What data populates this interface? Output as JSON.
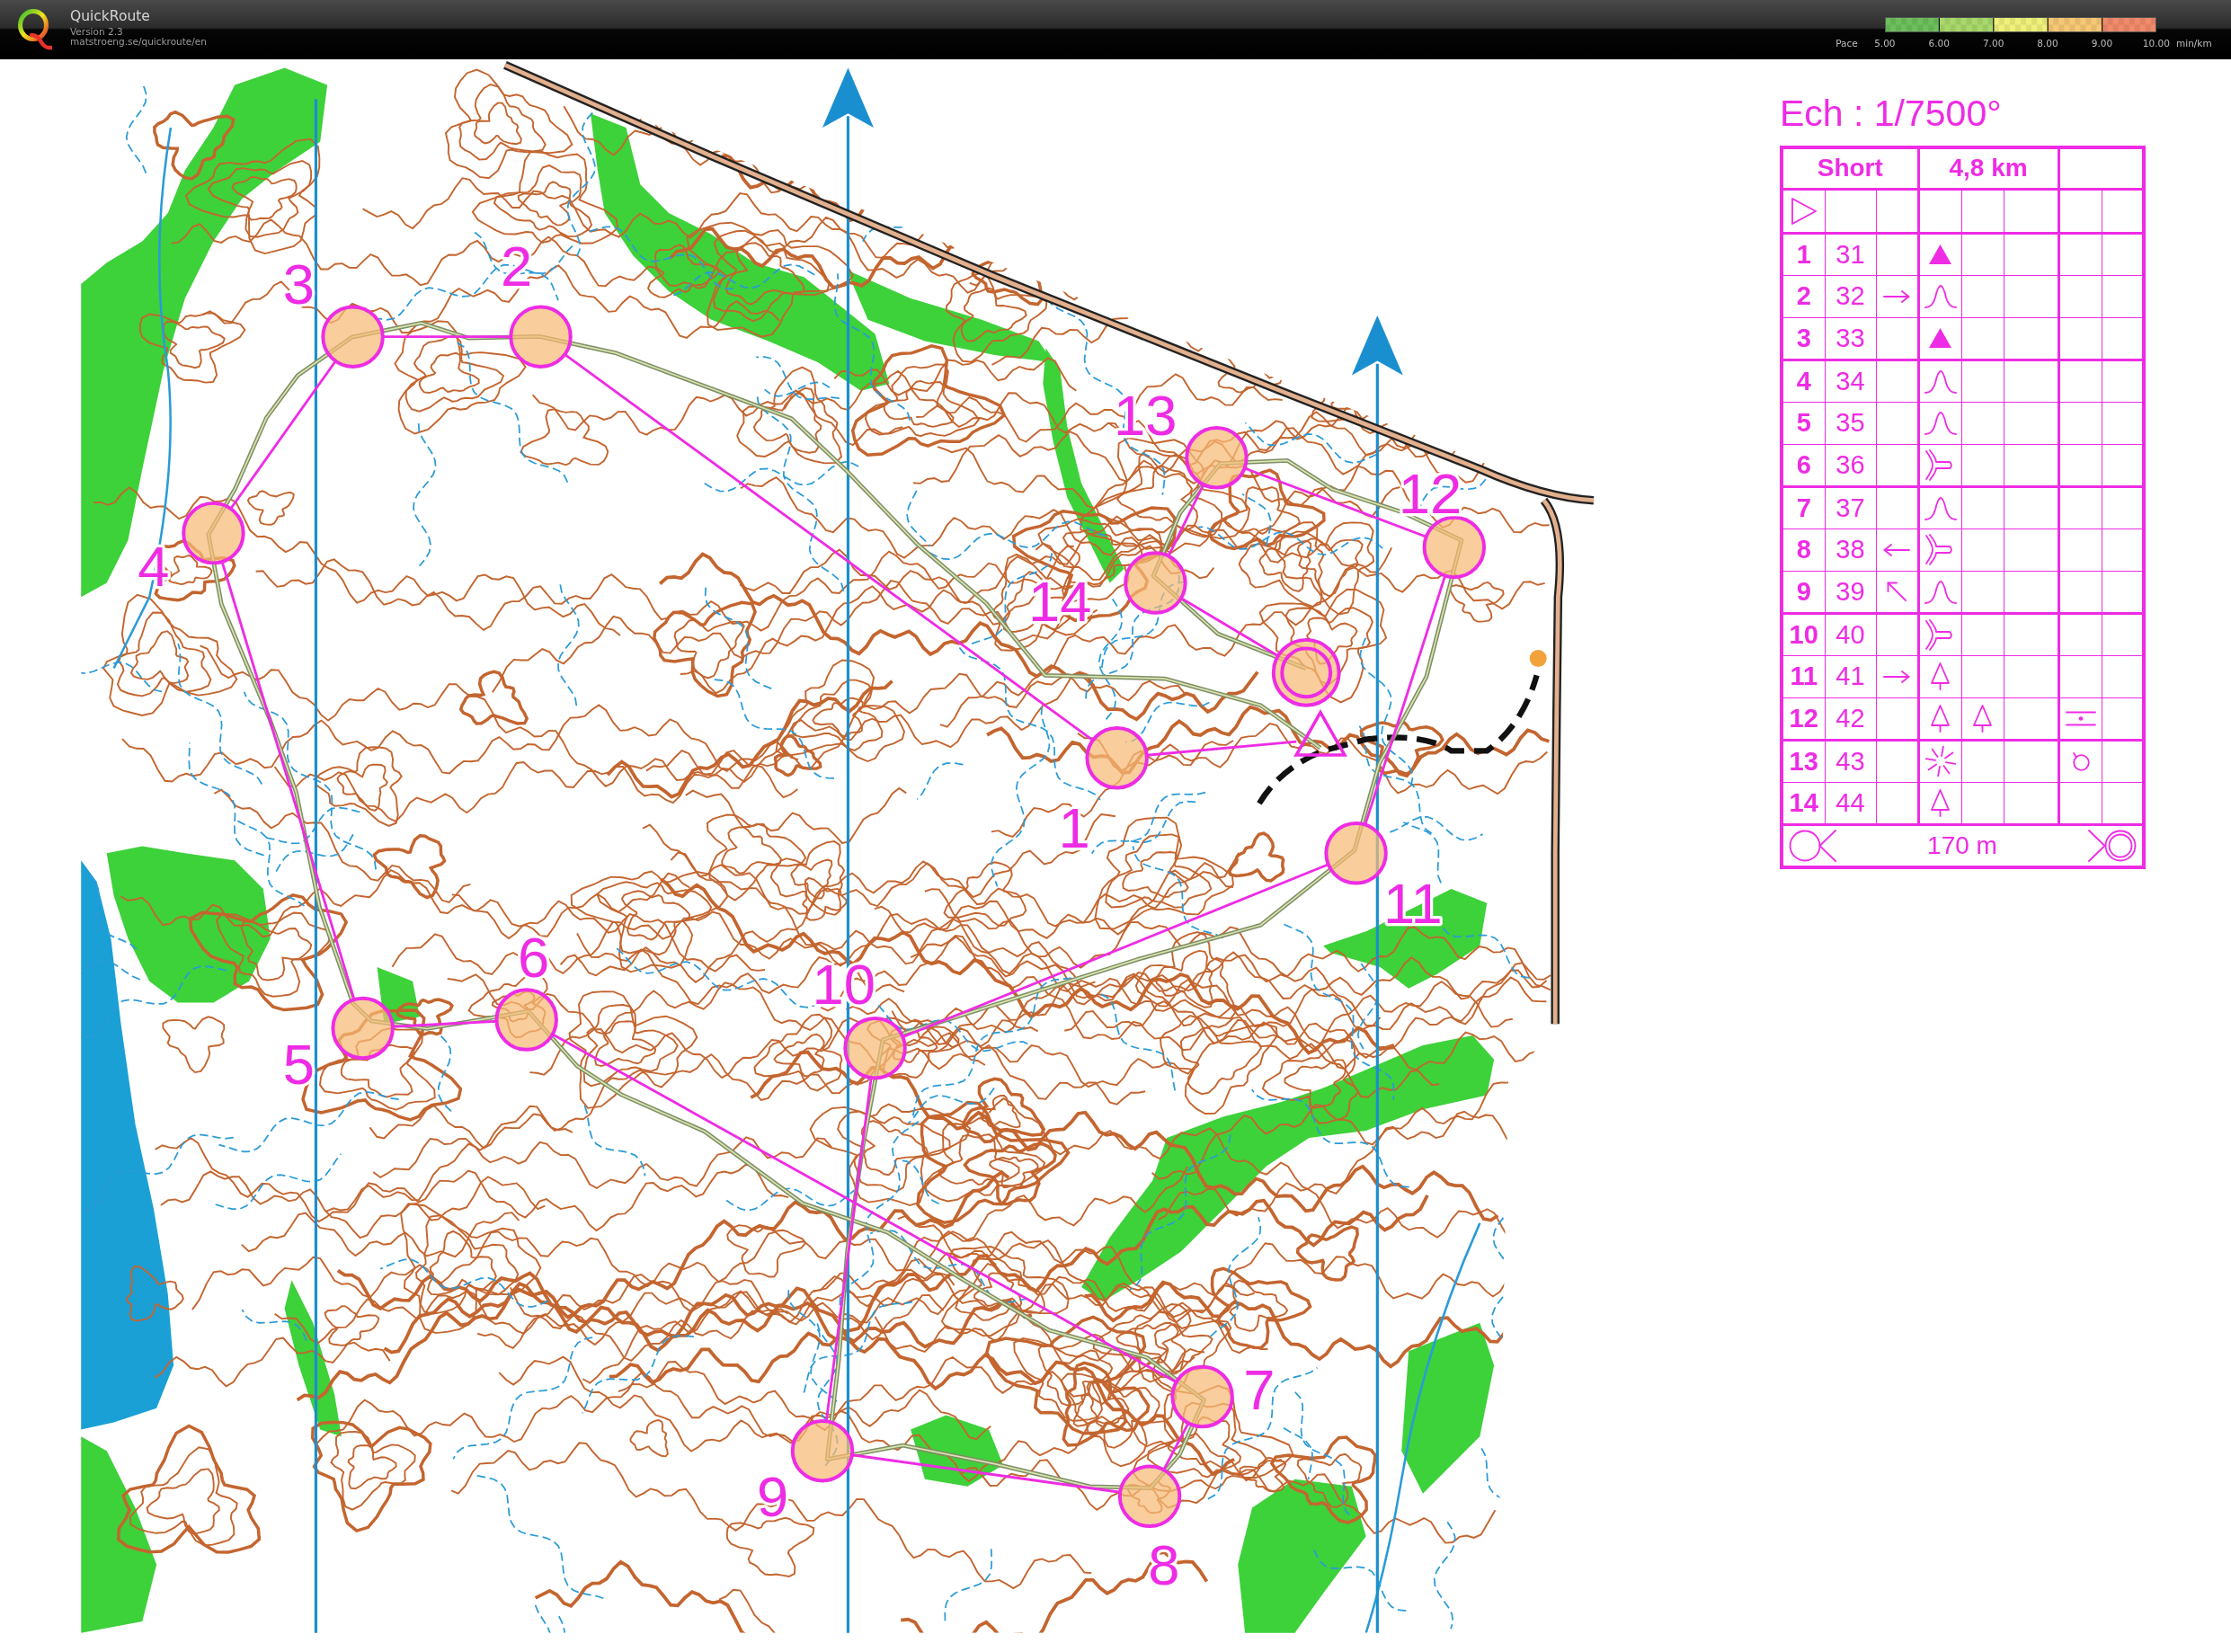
{
  "app_bar": {
    "title": "QuickRoute",
    "version": "Version 2.3",
    "url": "matstroeng.se/quickroute/en"
  },
  "pace_legend": {
    "label": "Pace",
    "ticks": [
      "5.00",
      "6.00",
      "7.00",
      "8.00",
      "9.00",
      "10.00"
    ],
    "unit": "min/km"
  },
  "map": {
    "controls": [
      {
        "label": "1"
      },
      {
        "label": "2"
      },
      {
        "label": "3"
      },
      {
        "label": "4"
      },
      {
        "label": "5"
      },
      {
        "label": "6"
      },
      {
        "label": "7"
      },
      {
        "label": "8"
      },
      {
        "label": "9"
      },
      {
        "label": "10"
      },
      {
        "label": "11"
      },
      {
        "label": "12"
      },
      {
        "label": "13"
      },
      {
        "label": "14"
      }
    ]
  },
  "control_description": {
    "scale": "Ech : 1/7500°",
    "course": "Short",
    "length": "4,8 km",
    "rows": [
      {
        "number": "1",
        "code": "31",
        "cells": [
          {
            "kind": "blank"
          },
          {
            "kind": "triangle"
          },
          {
            "kind": "blank"
          },
          {
            "kind": "blank"
          },
          {
            "kind": "blank"
          },
          {
            "kind": "blank"
          }
        ]
      },
      {
        "number": "2",
        "code": "32",
        "cells": [
          {
            "kind": "east"
          },
          {
            "kind": "bell"
          },
          {
            "kind": "blank"
          },
          {
            "kind": "blank"
          },
          {
            "kind": "blank"
          },
          {
            "kind": "blank"
          }
        ]
      },
      {
        "number": "3",
        "code": "33",
        "cells": [
          {
            "kind": "blank"
          },
          {
            "kind": "triangle"
          },
          {
            "kind": "blank"
          },
          {
            "kind": "blank"
          },
          {
            "kind": "blank"
          },
          {
            "kind": "blank"
          }
        ]
      },
      {
        "number": "4",
        "code": "34",
        "cells": [
          {
            "kind": "blank"
          },
          {
            "kind": "bell"
          },
          {
            "kind": "blank"
          },
          {
            "kind": "blank"
          },
          {
            "kind": "blank"
          },
          {
            "kind": "blank"
          }
        ]
      },
      {
        "number": "5",
        "code": "35",
        "cells": [
          {
            "kind": "blank"
          },
          {
            "kind": "bell"
          },
          {
            "kind": "blank"
          },
          {
            "kind": "blank"
          },
          {
            "kind": "blank"
          },
          {
            "kind": "blank"
          }
        ]
      },
      {
        "number": "6",
        "code": "36",
        "cells": [
          {
            "kind": "blank"
          },
          {
            "kind": "fork"
          },
          {
            "kind": "blank"
          },
          {
            "kind": "blank"
          },
          {
            "kind": "blank"
          },
          {
            "kind": "blank"
          }
        ]
      },
      {
        "number": "7",
        "code": "37",
        "cells": [
          {
            "kind": "blank"
          },
          {
            "kind": "bell"
          },
          {
            "kind": "blank"
          },
          {
            "kind": "blank"
          },
          {
            "kind": "blank"
          },
          {
            "kind": "blank"
          }
        ]
      },
      {
        "number": "8",
        "code": "38",
        "cells": [
          {
            "kind": "west"
          },
          {
            "kind": "fork"
          },
          {
            "kind": "blank"
          },
          {
            "kind": "blank"
          },
          {
            "kind": "blank"
          },
          {
            "kind": "blank"
          }
        ]
      },
      {
        "number": "9",
        "code": "39",
        "cells": [
          {
            "kind": "northwest"
          },
          {
            "kind": "bell"
          },
          {
            "kind": "blank"
          },
          {
            "kind": "blank"
          },
          {
            "kind": "blank"
          },
          {
            "kind": "blank"
          }
        ]
      },
      {
        "number": "10",
        "code": "40",
        "cells": [
          {
            "kind": "blank"
          },
          {
            "kind": "fork"
          },
          {
            "kind": "blank"
          },
          {
            "kind": "blank"
          },
          {
            "kind": "blank"
          },
          {
            "kind": "blank"
          }
        ]
      },
      {
        "number": "11",
        "code": "41",
        "cells": [
          {
            "kind": "east"
          },
          {
            "kind": "tree"
          },
          {
            "kind": "blank"
          },
          {
            "kind": "blank"
          },
          {
            "kind": "blank"
          },
          {
            "kind": "blank"
          }
        ]
      },
      {
        "number": "12",
        "code": "42",
        "cells": [
          {
            "kind": "blank"
          },
          {
            "kind": "tree"
          },
          {
            "kind": "tree"
          },
          {
            "kind": "blank"
          },
          {
            "kind": "between"
          },
          {
            "kind": "blank"
          }
        ]
      },
      {
        "number": "13",
        "code": "43",
        "cells": [
          {
            "kind": "blank"
          },
          {
            "kind": "star"
          },
          {
            "kind": "blank"
          },
          {
            "kind": "blank"
          },
          {
            "kind": "ring"
          },
          {
            "kind": "blank"
          }
        ]
      },
      {
        "number": "14",
        "code": "44",
        "cells": [
          {
            "kind": "blank"
          },
          {
            "kind": "tree"
          },
          {
            "kind": "blank"
          },
          {
            "kind": "blank"
          },
          {
            "kind": "blank"
          },
          {
            "kind": "blank"
          }
        ]
      }
    ],
    "finish_distance": "170 m"
  }
}
